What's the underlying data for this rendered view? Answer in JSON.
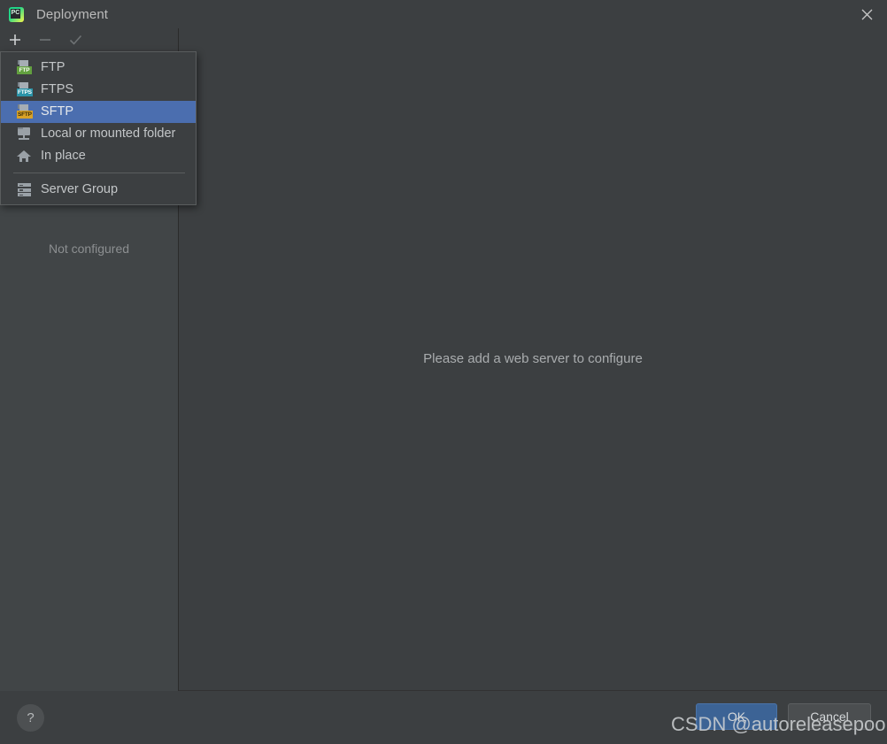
{
  "window": {
    "title": "Deployment",
    "app_icon": "pycharm-logo-icon",
    "app_icon_text": "PC",
    "close_icon": "close-icon"
  },
  "left_panel": {
    "toolbar": {
      "add_label": "+",
      "remove_label": "−",
      "apply_label": "✓",
      "add_icon": "plus-icon",
      "remove_icon": "minus-icon",
      "apply_icon": "checkmark-icon"
    },
    "status_text": "Not configured"
  },
  "popup_menu": {
    "items": [
      {
        "label": "FTP",
        "icon": "ftp-icon",
        "badge": "FTP",
        "selected": false
      },
      {
        "label": "FTPS",
        "icon": "ftps-icon",
        "badge": "FTPS",
        "selected": false
      },
      {
        "label": "SFTP",
        "icon": "sftp-icon",
        "badge": "SFTP",
        "selected": true
      },
      {
        "label": "Local or mounted folder",
        "icon": "local-folder-icon",
        "selected": false
      },
      {
        "label": "In place",
        "icon": "home-icon",
        "selected": false
      },
      {
        "label": "Server Group",
        "icon": "server-group-icon",
        "selected": false
      }
    ]
  },
  "main": {
    "empty_message": "Please add a web server to configure"
  },
  "footer": {
    "help_label": "?",
    "help_icon": "question-mark-icon",
    "ok_label": "OK",
    "cancel_label": "Cancel"
  },
  "watermark": {
    "text": "CSDN @autoreleasepools"
  },
  "colors": {
    "background": "#3c3f41",
    "panel": "#414547",
    "selection": "#4b6eaf",
    "ok_button": "#3c6395",
    "badge_ftp": "#62a03f",
    "badge_ftps": "#2a93a8",
    "badge_sftp": "#d9a227"
  }
}
